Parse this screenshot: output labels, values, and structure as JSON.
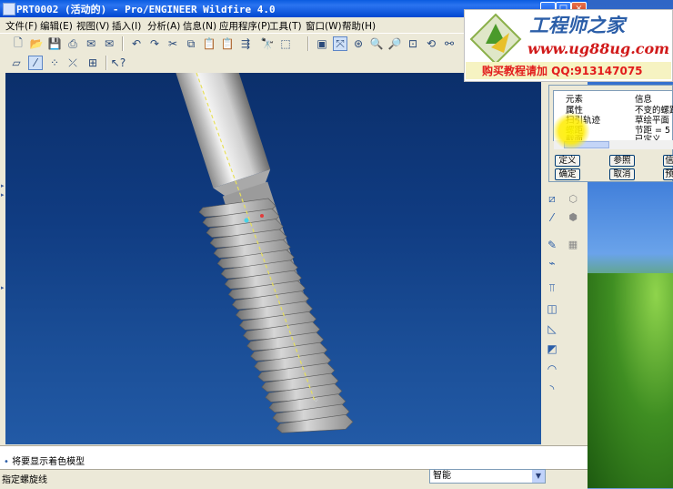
{
  "window": {
    "title": "PRT0002 (活动的) - Pro/ENGINEER Wildfire 4.0",
    "controls": [
      "_",
      "□",
      "×"
    ]
  },
  "menubar": [
    {
      "label": "文件(F)"
    },
    {
      "label": "编辑(E)"
    },
    {
      "label": "视图(V)"
    },
    {
      "label": "插入(I)"
    },
    {
      "label": "分析(A)"
    },
    {
      "label": "信息(N)"
    },
    {
      "label": "应用程序(P)"
    },
    {
      "label": "工具(T)"
    },
    {
      "label": "窗口(W)"
    },
    {
      "label": "帮助(H)"
    }
  ],
  "dialog": {
    "headers": [
      "元素",
      "信息"
    ],
    "rows": [
      {
        "element": "属性",
        "info": "不变的螺距"
      },
      {
        "element": "扫引轨迹",
        "info": "草绘平面"
      },
      {
        "element": "螺距",
        "info": "节距 = 5"
      },
      {
        "element": "截面",
        "info": "已定义"
      }
    ],
    "buttons": [
      "定义",
      "参照",
      "信",
      "确定",
      "取消",
      "预"
    ]
  },
  "message": "将要显示着色模型",
  "status": "指定螺旋线",
  "filter": {
    "selected": "智能"
  },
  "banner": {
    "title": "工程师之家",
    "url": "www.ug88ug.com",
    "ad": "购买教程请加 QQ:913147075"
  },
  "colors": {
    "accent": "#2b74f0",
    "graphics_top": "#0b2f6b",
    "graphics_bottom": "#225aa6",
    "banner_red": "#d11a1a"
  }
}
